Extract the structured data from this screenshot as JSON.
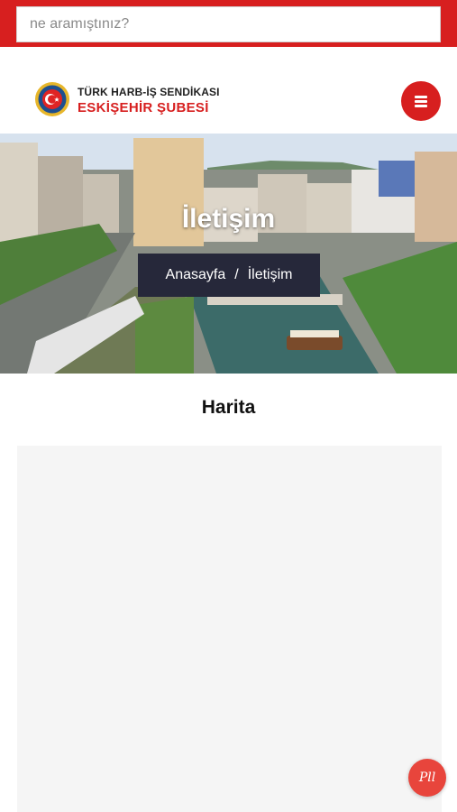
{
  "search": {
    "placeholder": "ne aramıştınız?"
  },
  "header": {
    "logo_line1": "TÜRK HARB-İŞ SENDİKASI",
    "logo_line2": "ESKİŞEHİR ŞUBESİ"
  },
  "hero": {
    "title": "İletişim",
    "breadcrumb": {
      "home": "Anasayfa",
      "separator": "/",
      "current": "İletişim"
    }
  },
  "main": {
    "section_title": "Harita"
  },
  "chat": {
    "badge_text": "Pll"
  },
  "colors": {
    "accent": "#d71f1f",
    "breadcrumb_bg": "#26283a",
    "map_bg": "#f5f5f5"
  }
}
